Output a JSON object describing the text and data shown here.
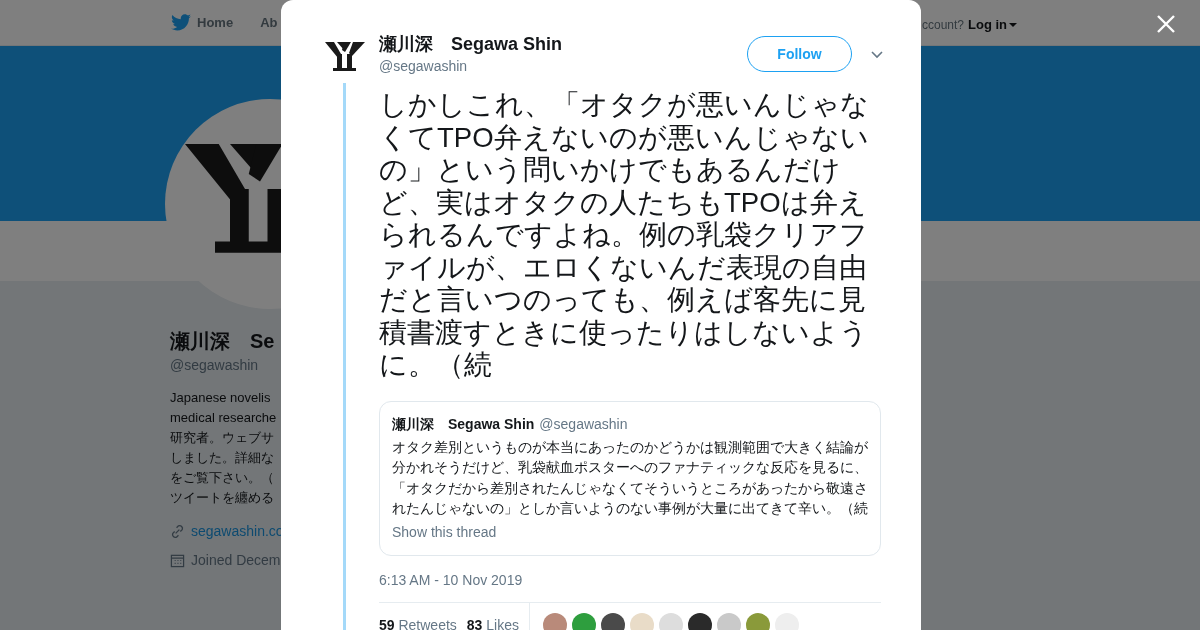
{
  "background_page": {
    "nav": {
      "home": "Home",
      "about": "Ab",
      "account_prompt": "ccount?",
      "login": "Log in"
    },
    "profile": {
      "name": "瀬川深　Se",
      "handle": "@segawashin",
      "bio_lines": [
        "Japanese novelis",
        "medical researche",
        "研究者。ウェブサ",
        "しました。詳細な",
        "をご覧下さい。（",
        "ツイートを纏める"
      ],
      "link": "segawashin.co",
      "joined": "Joined Decem"
    }
  },
  "modal": {
    "author": {
      "name": "瀬川深　Segawa Shin",
      "handle": "@segawashin"
    },
    "follow_button": "Follow",
    "tweet_text": "しかしこれ、「オタクが悪いんじゃなくてTPO弁えないのが悪いんじゃないの」という問いかけでもあるんだけど、実はオタクの人たちもTPOは弁えられるんですよね。例の乳袋クリアファイルが、エロくないんだ表現の自由だと言いつのっても、例えば客先に見積書渡すときに使ったりはしないように。（続",
    "quoted_tweet": {
      "name": "瀬川深　Segawa Shin",
      "handle": "@segawashin",
      "text": "オタク差別というものが本当にあったのかどうかは観測範囲で大きく結論が分かれそうだけど、乳袋献血ポスターへのファナティックな反応を見るに、「オタクだから差別されたんじゃなくてそういうところがあったから敬遠されたんじゃないの」としか言いようのない事例が大量に出てきて辛い。（続",
      "show_thread": "Show this thread"
    },
    "timestamp": "6:13 AM - 10 Nov 2019",
    "stats": [
      {
        "count": "59",
        "label": "Retweets"
      },
      {
        "count": "83",
        "label": "Likes"
      }
    ],
    "liked_by": [
      {
        "color": "#b98a7a"
      },
      {
        "color": "#2e9e3e"
      },
      {
        "color": "#4a4a4a"
      },
      {
        "color": "#e9dcc8"
      },
      {
        "color": "#dddddd"
      },
      {
        "color": "#2a2a2a"
      },
      {
        "color": "#c9c9c9"
      },
      {
        "color": "#8a9a3a"
      },
      {
        "color": "#eeeeee"
      }
    ]
  }
}
